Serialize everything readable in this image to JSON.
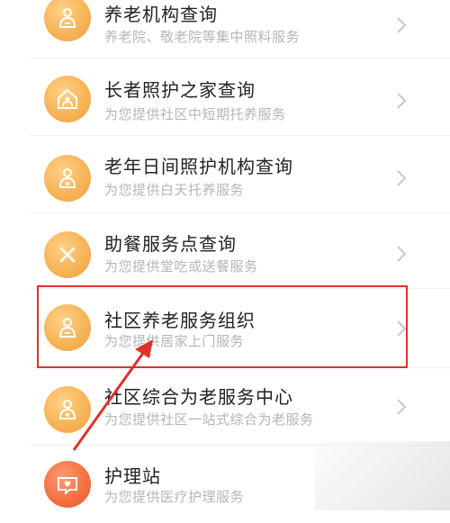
{
  "items": [
    {
      "title": "养老机构查询",
      "subtitle": "养老院、敬老院等集中照料服务",
      "icon": "elder-care-home-icon"
    },
    {
      "title": "长者照护之家查询",
      "subtitle": "为您提供社区中短期托养服务",
      "icon": "house-care-icon"
    },
    {
      "title": "老年日间照护机构查询",
      "subtitle": "为您提供白天托养服务",
      "icon": "day-care-icon"
    },
    {
      "title": "助餐服务点查询",
      "subtitle": "为您提供堂吃或送餐服务",
      "icon": "meal-service-icon"
    },
    {
      "title": "社区养老服务组织",
      "subtitle": "为您提供居家上门服务",
      "icon": "community-service-icon"
    },
    {
      "title": "社区综合为老服务中心",
      "subtitle": "为您提供社区一站式综合为老服务",
      "icon": "community-center-icon"
    },
    {
      "title": "护理站",
      "subtitle": "为您提供医疗护理服务",
      "icon": "nursing-station-icon"
    }
  ],
  "colors": {
    "icon_orange": "#f7b457",
    "icon_red": "#f46e40",
    "highlight_red": "#e0312c",
    "title_text": "#222222",
    "subtitle_text": "#b5b5b5"
  }
}
